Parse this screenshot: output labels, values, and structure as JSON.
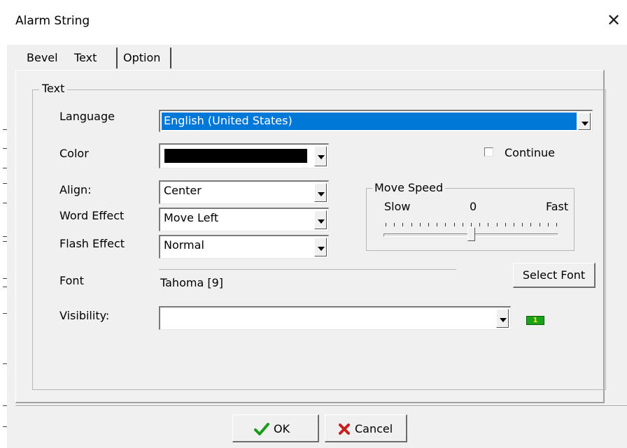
{
  "window": {
    "title": "Alarm String"
  },
  "tabs": [
    {
      "label": "Bevel"
    },
    {
      "label": "Text"
    },
    {
      "label": "Option"
    }
  ],
  "group": {
    "legend": "Text"
  },
  "fields": {
    "language": {
      "label": "Language",
      "value": "English (United States)"
    },
    "color": {
      "label": "Color",
      "value": "#000000"
    },
    "continue": {
      "label": "Continue",
      "checked": false
    },
    "align": {
      "label": "Align:",
      "value": "Center"
    },
    "word_effect": {
      "label": "Word Effect",
      "value": "Move Left"
    },
    "flash_effect": {
      "label": "Flash Effect",
      "value": "Normal"
    },
    "font": {
      "label": "Font",
      "value": "Tahoma [9]"
    },
    "visibility": {
      "label": "Visibility:",
      "value": ""
    }
  },
  "move_speed": {
    "legend": "Move Speed",
    "slow": "Slow",
    "value": "0",
    "fast": "Fast",
    "position": 0.5
  },
  "buttons": {
    "select_font": "Select Font",
    "ok": "OK",
    "cancel": "Cancel"
  },
  "visibility_badge": "1",
  "colors": {
    "selection": "#0078d7",
    "badge": "#1aa01a"
  }
}
